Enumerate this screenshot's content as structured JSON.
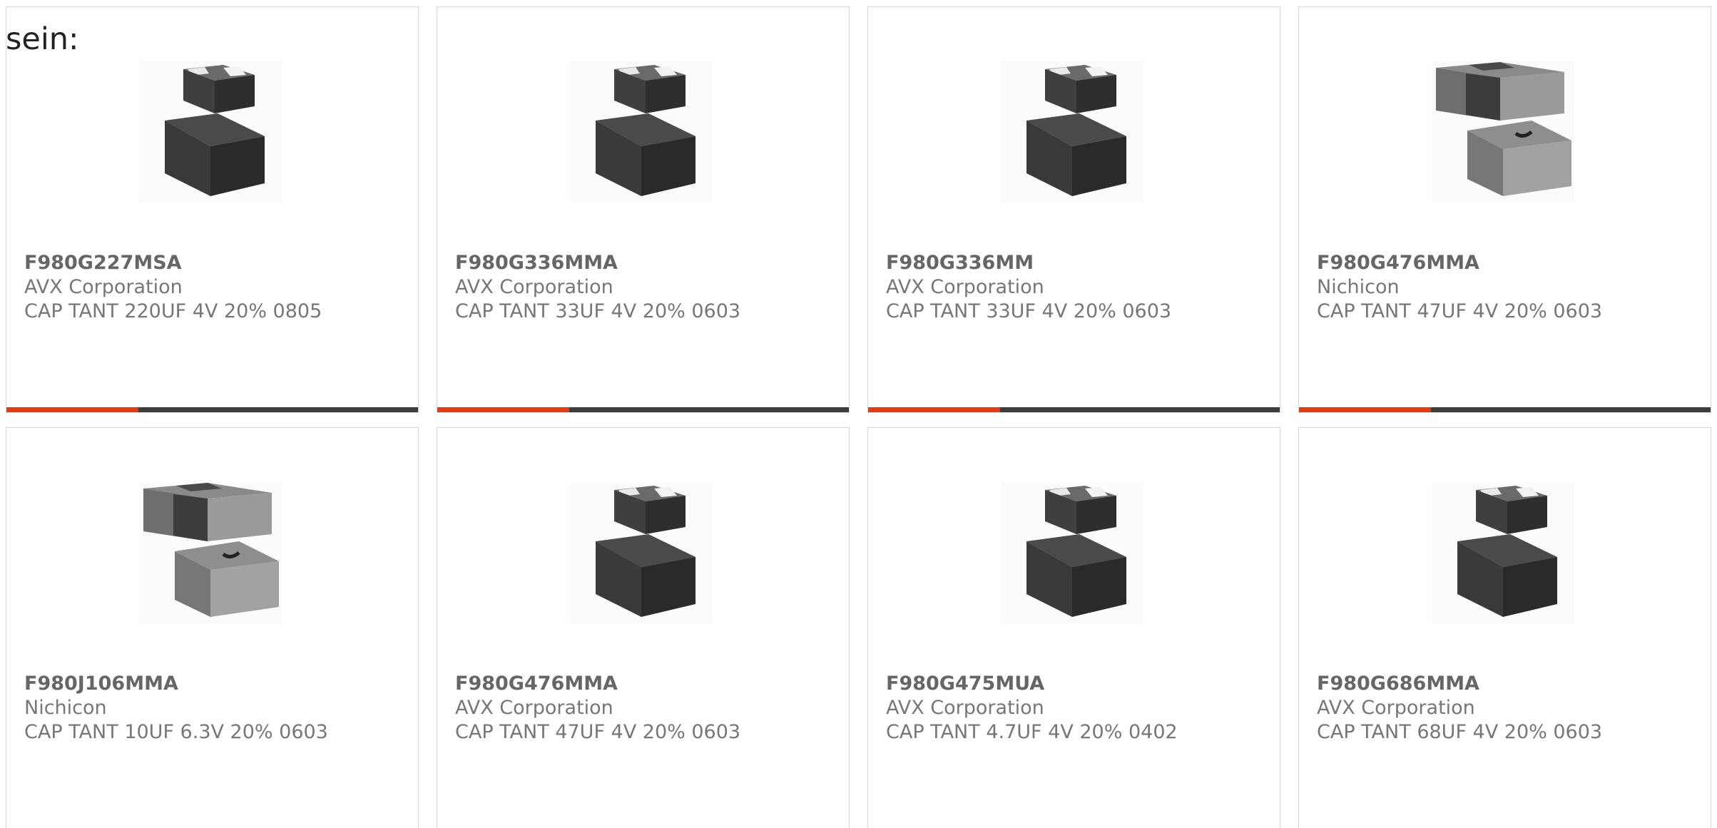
{
  "lead_text": "sein:",
  "accent_color": "#e23a12",
  "bar_track_color": "#3c3c3c",
  "cards": [
    {
      "part_number": "F980G227MSA",
      "manufacturer": "AVX Corporation",
      "description": "CAP TANT 220UF 4V 20% 0805",
      "image": "tantalum-capacitor-dark-image",
      "progress": 0.32
    },
    {
      "part_number": "F980G336MMA",
      "manufacturer": "AVX Corporation",
      "description": "CAP TANT 33UF 4V 20% 0603",
      "image": "tantalum-capacitor-dark-image",
      "progress": 0.32
    },
    {
      "part_number": "F980G336MM",
      "manufacturer": "AVX Corporation",
      "description": "CAP TANT 33UF 4V 20% 0603",
      "image": "tantalum-capacitor-dark-image",
      "progress": 0.32
    },
    {
      "part_number": "F980G476MMA",
      "manufacturer": "Nichicon",
      "description": "CAP TANT 47UF 4V 20% 0603",
      "image": "tantalum-capacitor-grey-image",
      "progress": 0.32
    },
    {
      "part_number": "F980J106MMA",
      "manufacturer": "Nichicon",
      "description": "CAP TANT 10UF 6.3V 20% 0603",
      "image": "tantalum-capacitor-grey-image"
    },
    {
      "part_number": "F980G476MMA",
      "manufacturer": "AVX Corporation",
      "description": "CAP TANT 47UF 4V 20% 0603",
      "image": "tantalum-capacitor-dark-image"
    },
    {
      "part_number": "F980G475MUA",
      "manufacturer": "AVX Corporation",
      "description": "CAP TANT 4.7UF 4V 20% 0402",
      "image": "tantalum-capacitor-dark-image"
    },
    {
      "part_number": "F980G686MMA",
      "manufacturer": "AVX Corporation",
      "description": "CAP TANT 68UF 4V 20% 0603",
      "image": "tantalum-capacitor-dark-image"
    }
  ]
}
